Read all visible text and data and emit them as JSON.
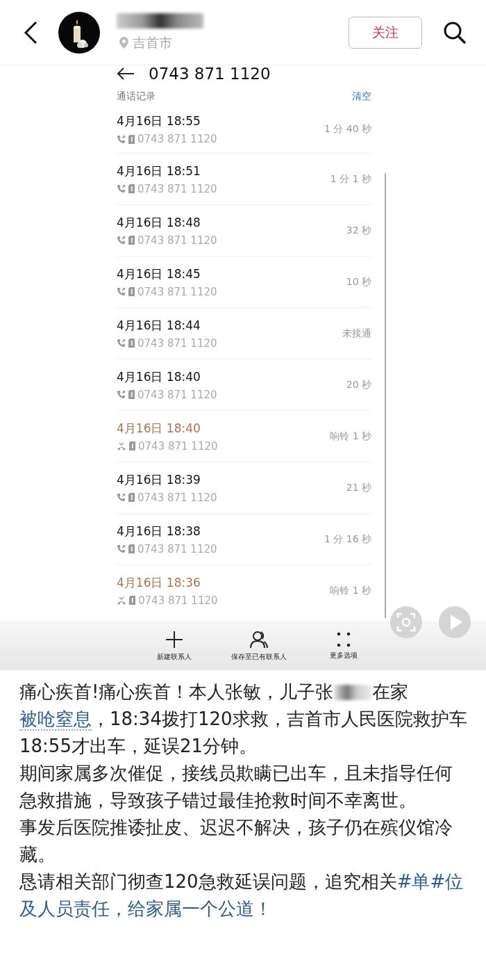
{
  "header": {
    "location": "吉首市",
    "follow_button": "关注"
  },
  "call_log": {
    "number": "0743 871 1120",
    "section_title": "通话记录",
    "clear_link": "清空",
    "calls": [
      {
        "kind": "outgoing",
        "time": "4月16日 18:55",
        "number": "0743 871 1120",
        "duration": "1 分 40 秒"
      },
      {
        "kind": "outgoing",
        "time": "4月16日 18:51",
        "number": "0743 871 1120",
        "duration": "1 分 1 秒"
      },
      {
        "kind": "outgoing",
        "time": "4月16日 18:48",
        "number": "0743 871 1120",
        "duration": "32 秒"
      },
      {
        "kind": "outgoing",
        "time": "4月16日 18:45",
        "number": "0743 871 1120",
        "duration": "10 秒"
      },
      {
        "kind": "outgoing",
        "time": "4月16日 18:44",
        "number": "0743 871 1120",
        "duration": "未接通"
      },
      {
        "kind": "outgoing",
        "time": "4月16日 18:40",
        "number": "0743 871 1120",
        "duration": "20 秒"
      },
      {
        "kind": "missed",
        "time": "4月16日 18:40",
        "number": "0743 871 1120",
        "duration": "响铃 1 秒"
      },
      {
        "kind": "outgoing",
        "time": "4月16日 18:39",
        "number": "0743 871 1120",
        "duration": "21 秒"
      },
      {
        "kind": "outgoing",
        "time": "4月16日 18:38",
        "number": "0743 871 1120",
        "duration": "1 分 16 秒"
      },
      {
        "kind": "missed",
        "time": "4月16日 18:36",
        "number": "0743 871 1120",
        "duration": "响铃 1 秒"
      }
    ],
    "actions": [
      {
        "kind": "add",
        "label": "新建联系人"
      },
      {
        "kind": "person",
        "label": "保存至已有联系人"
      },
      {
        "kind": "more",
        "label": "更多选项"
      }
    ]
  },
  "post": {
    "paragraphs": [
      [
        {
          "kind": "text",
          "text": "痛心疾首!痛心疾首！本人张敏，儿子张"
        },
        {
          "kind": "redacted"
        },
        {
          "kind": "text",
          "text": "在家"
        },
        {
          "kind": "link",
          "text": "被呛窒息"
        },
        {
          "kind": "text",
          "text": "，18:34拨打120求救，吉首市人民医院救护车18:55才出车，延误21分钟。"
        }
      ],
      [
        {
          "kind": "text",
          "text": "期间家属多次催促，接线员欺瞒已出车，且未指导任何急救措施，导致孩子错过最佳抢救时间不幸离世。"
        }
      ],
      [
        {
          "kind": "text",
          "text": "事发后医院推诿扯皮、迟迟不解决，孩子仍在殡仪馆冷藏。"
        }
      ],
      [
        {
          "kind": "text",
          "text": "恳请相关部门彻查120急救延误问题，追究相关"
        },
        {
          "kind": "hashtag",
          "text": "#单#位"
        },
        {
          "kind": "hashtag",
          "text": "及人员责任，给家属一个公道！"
        }
      ]
    ]
  }
}
